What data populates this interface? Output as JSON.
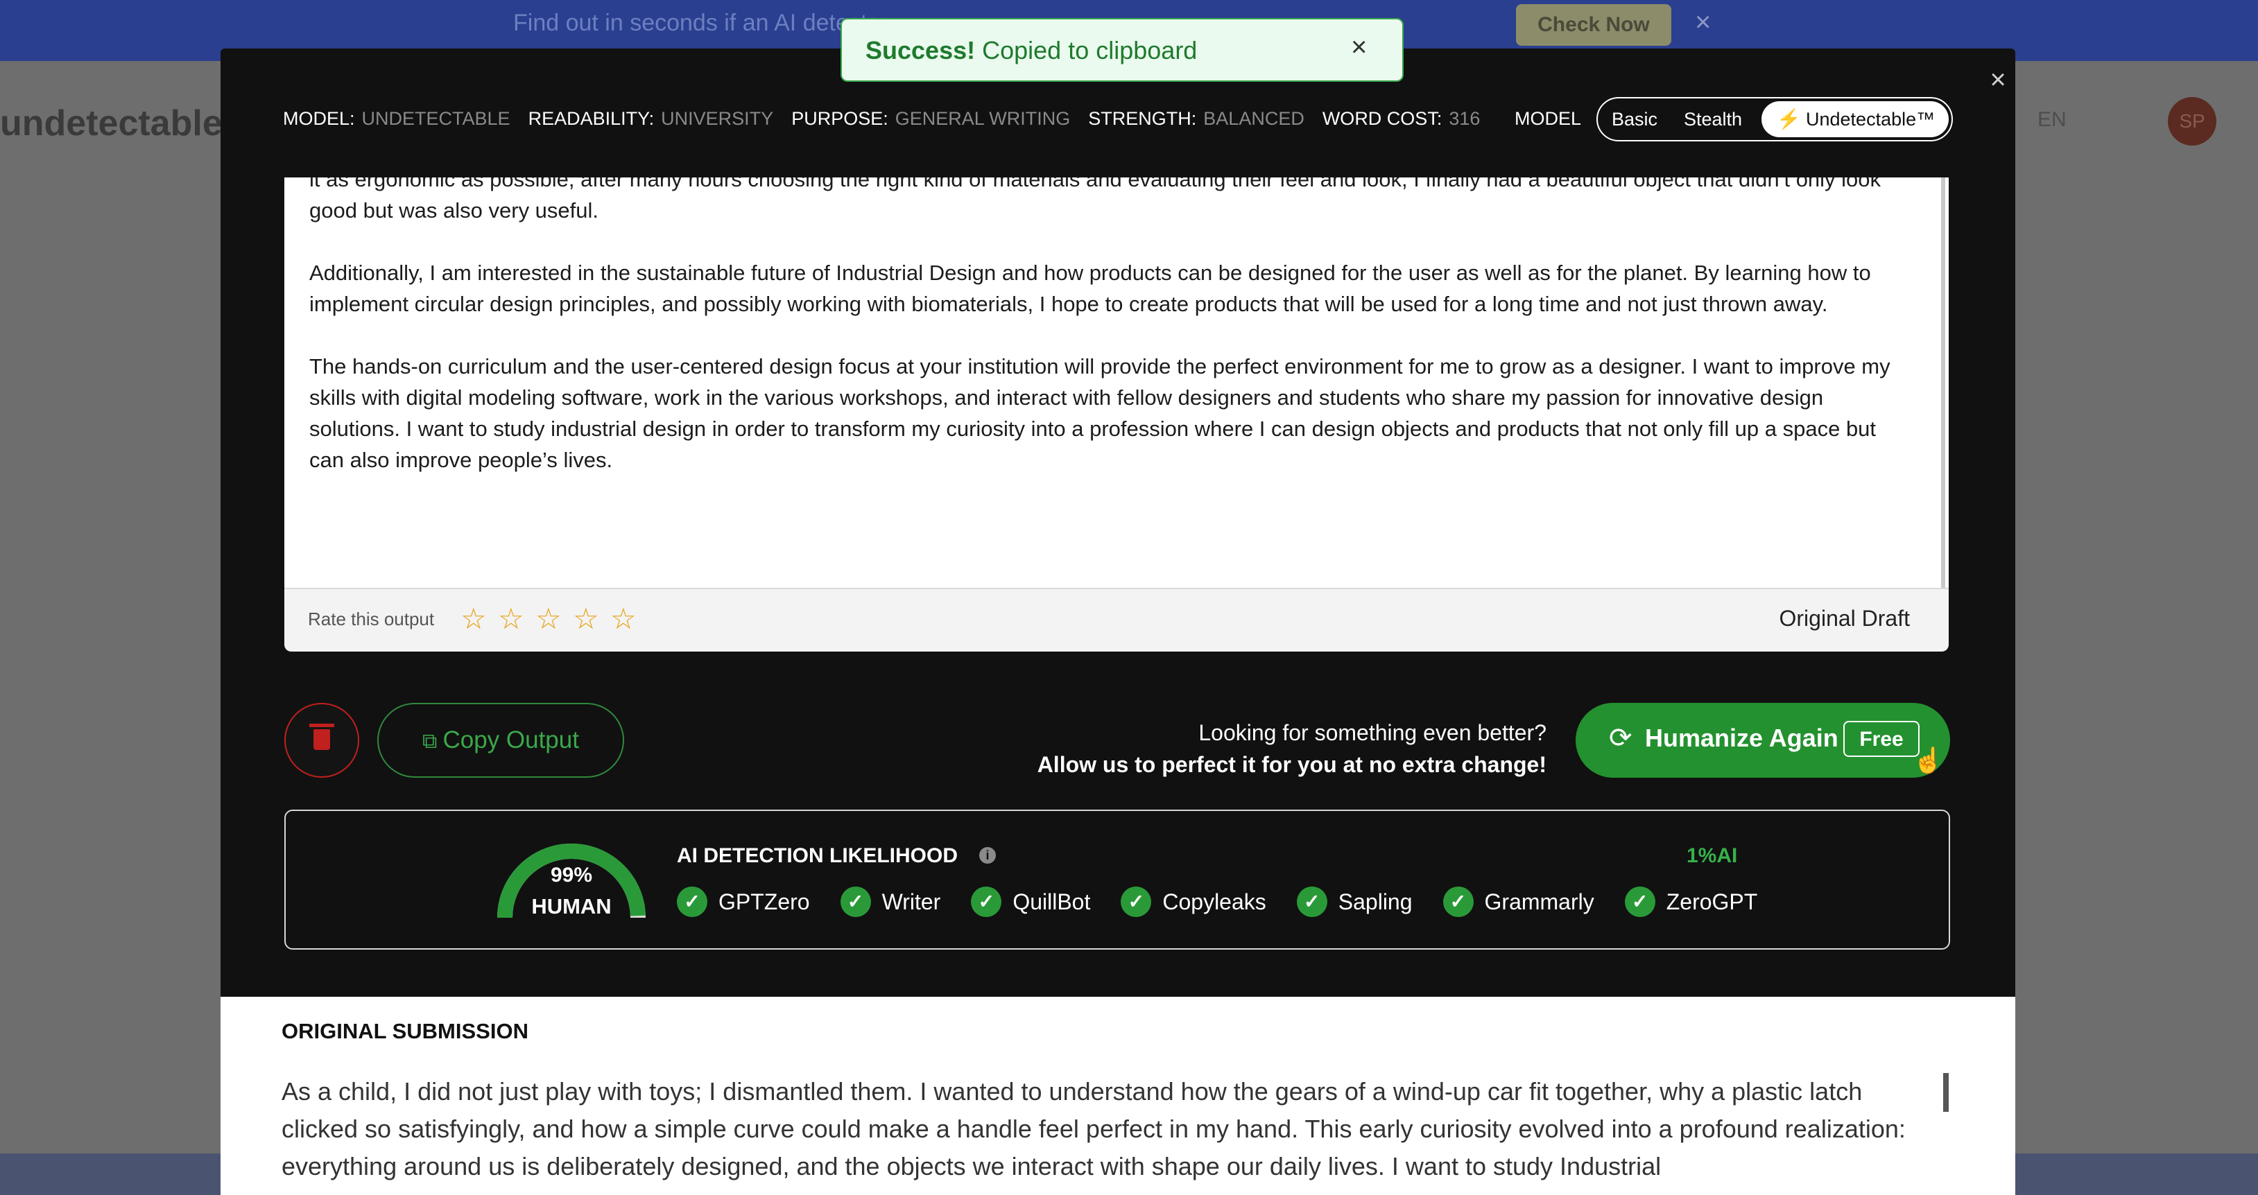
{
  "background": {
    "banner_text": "Find out in seconds if an AI detector...",
    "banner_button": "Check Now",
    "logo": "undetectable",
    "lang": "EN",
    "avatar_initials": "SP"
  },
  "toast": {
    "strong": "Success!",
    "message": "Copied to clipboard",
    "close": "×"
  },
  "modal": {
    "close": "×"
  },
  "meta": {
    "items": [
      {
        "key": "MODEL:",
        "value": "UNDETECTABLE"
      },
      {
        "key": "READABILITY:",
        "value": "UNIVERSITY"
      },
      {
        "key": "PURPOSE:",
        "value": "GENERAL WRITING"
      },
      {
        "key": "STRENGTH:",
        "value": "BALANCED"
      },
      {
        "key": "WORD COST:",
        "value": "316"
      }
    ],
    "model_label": "MODEL",
    "toggle": {
      "basic": "Basic",
      "stealth": "Stealth",
      "undetectable": "Undetectable™",
      "selected": "Undetectable™"
    }
  },
  "output": {
    "paragraphs": [
      "…the right kind of materials and evaluating their feel and look, I finally had a beautiful object that didn't only look good but was also very useful.",
      "Additionally, I am interested in the sustainable future of Industrial Design and how products can be designed for the user as well as for the planet. By learning how to implement circular design principles, and possibly working with biomaterials, I hope to create products that will be used for a long time and not just thrown away.",
      "The hands-on curriculum and the user-centered design focus at your institution will provide the perfect environment for me to grow as a designer. I want to improve my skills with digital modeling software, work in the various workshops, and interact with fellow designers and students who share my passion for innovative design solutions. I want to study industrial design in order to transform my curiosity into a profession where I can design objects and products that not only fill up a space but can also improve people’s lives."
    ],
    "first_line": "it as ergonomic as possible, after many hours choosing the right kind of materials and evaluating their feel and look, I finally had a beautiful object that didn’t only look good but was also very useful.",
    "rate_label": "Rate this output",
    "rating": 0,
    "max_rating": 5,
    "original_draft": "Original Draft"
  },
  "actions": {
    "copy": "Copy Output",
    "better_line1": "Looking for something even better?",
    "better_line2": "Allow us to perfect it for you at no extra change!",
    "humanize": "Humanize Again",
    "free": "Free"
  },
  "detection": {
    "human_pct": "99%",
    "human_label": "HUMAN",
    "human_fraction": 0.99,
    "title": "AI DETECTION LIKELIHOOD",
    "ai_pct": "1%AI",
    "detectors": [
      "GPTZero",
      "Writer",
      "QuillBot",
      "Copyleaks",
      "Sapling",
      "Grammarly",
      "ZeroGPT"
    ],
    "accent": "#2a9a39"
  },
  "original": {
    "title": "ORIGINAL SUBMISSION",
    "text": "As a child, I did not just play with toys; I dismantled them. I wanted to understand how the gears of a wind-up car fit together, why a plastic latch clicked so satisfyingly, and how a simple curve could make a handle feel perfect in my hand. This early curiosity evolved into a profound realization: everything around us is deliberately designed, and the objects we interact with shape our daily lives. I want to study Industrial"
  }
}
